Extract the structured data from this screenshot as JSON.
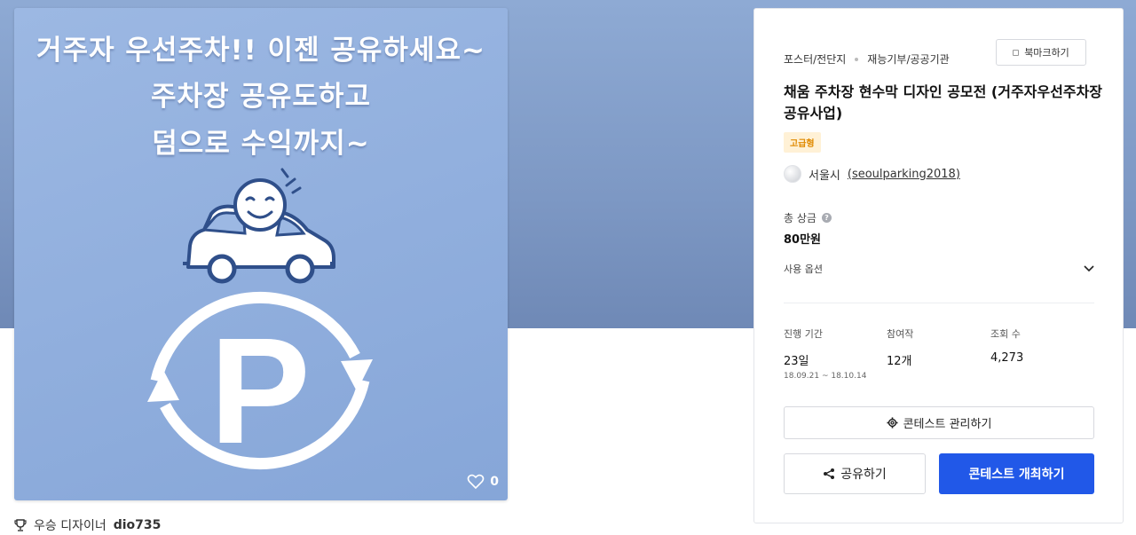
{
  "poster": {
    "line1": "거주자 우선주차!! 이젠 공유하세요~",
    "line2": "주차장 공유도하고",
    "line3": "덤으로 수익까지~",
    "like_count": "0",
    "poster_letter": "P"
  },
  "award": {
    "prefix": "우승 디자이너",
    "designer": "dio735"
  },
  "panel": {
    "category1": "포스터/전단지",
    "category2": "재능기부/공공기관",
    "bookmark_label": "북마크하기",
    "title": "채움 주차장 현수막 디자인 공모전 (거주자우선주차장 공유사업)",
    "badge": "고급형",
    "host_name": "서울시",
    "host_id": "(seoulparking2018)",
    "prize_label": "총 상금",
    "prize_value": "80만원",
    "options_label": "사용 옵션",
    "stats": {
      "period_label": "진행 기간",
      "period_value": "23일",
      "period_range": "18.09.21 ~ 18.10.14",
      "entries_label": "참여작",
      "entries_value": "12개",
      "views_label": "조회 수",
      "views_value": "4,273"
    },
    "manage_label": "콘테스트 관리하기",
    "share_label": "공유하기",
    "host_contest_label": "콘테스트 개최하기"
  },
  "colors": {
    "hero": "#8eaad4",
    "poster": "#92b0de",
    "primary": "#2158e8",
    "badge_bg": "#fff1d6",
    "badge_text": "#e08a00"
  }
}
